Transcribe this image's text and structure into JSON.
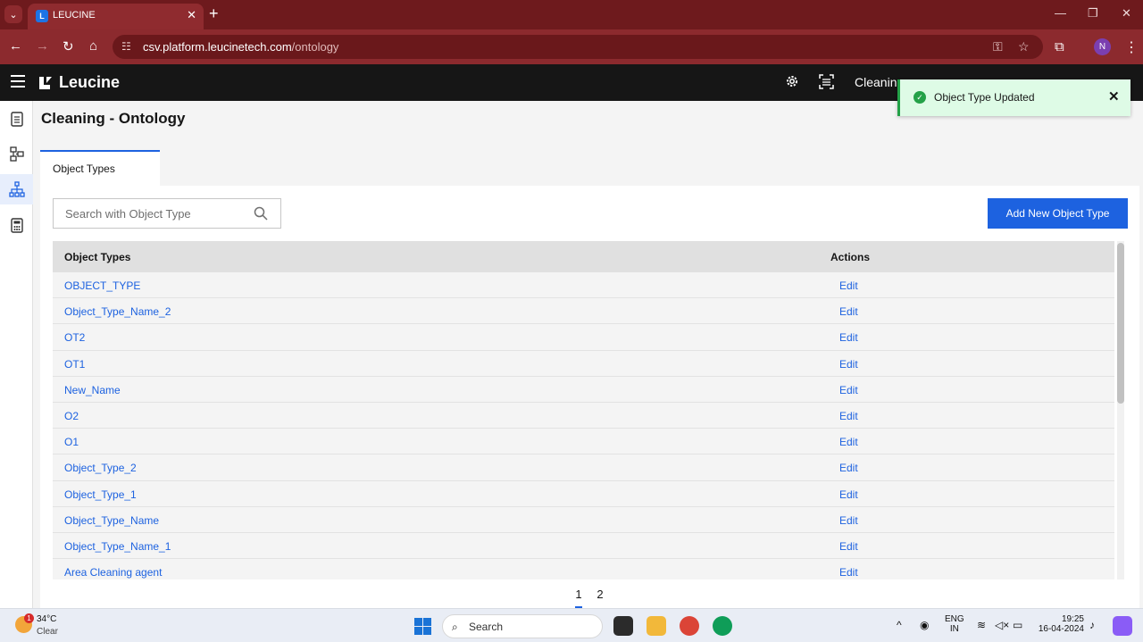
{
  "browser": {
    "tab_title": "LEUCINE",
    "new_tab": "+",
    "tab_close": "✕",
    "url_host": "csv.platform.leucinetech.com",
    "url_path": "/ontology",
    "profile_initial": "N",
    "window_controls": {
      "minimize": "—",
      "restore": "❐",
      "close": "✕"
    }
  },
  "app": {
    "brand": "Leucine",
    "facility_label": "Cleaning"
  },
  "page": {
    "title": "Cleaning - Ontology",
    "tabs": [
      {
        "label": "Object Types"
      }
    ],
    "search_placeholder": "Search with Object Type",
    "add_button": "Add New Object Type"
  },
  "table": {
    "columns": {
      "name": "Object Types",
      "actions": "Actions"
    },
    "edit_label": "Edit",
    "rows": [
      "OBJECT_TYPE",
      "Object_Type_Name_2",
      "OT2",
      "OT1",
      "New_Name",
      "O2",
      "O1",
      "Object_Type_2",
      "Object_Type_1",
      "Object_Type_Name",
      "Object_Type_Name_1",
      "Area Cleaning agent"
    ]
  },
  "pagination": {
    "pages": [
      "1",
      "2"
    ],
    "current": "1"
  },
  "toast": {
    "message": "Object Type Updated"
  },
  "taskbar": {
    "temperature": "34°C",
    "condition": "Clear",
    "weather_badge": "1",
    "search_label": "Search",
    "language": "ENG",
    "region": "IN",
    "time": "19:25",
    "date": "16-04-2024"
  },
  "colors": {
    "accent": "#1d62e0",
    "success": "#24a148",
    "browser_frame": "#6e1a1d",
    "app_header": "#161616"
  },
  "icons": {
    "settings": "gear-icon",
    "scan": "scan-icon",
    "search": "search-icon",
    "toast": "check-circle-icon"
  }
}
